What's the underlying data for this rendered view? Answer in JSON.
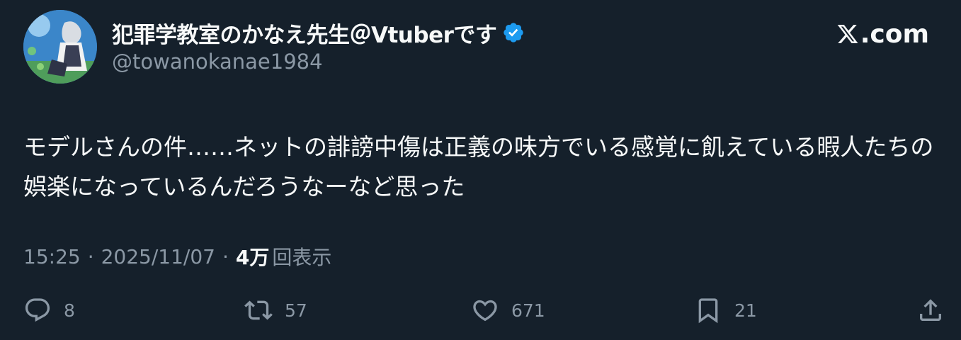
{
  "user": {
    "display_name": "犯罪学教室のかなえ先生＠Vtuberです",
    "handle": "@towanokanae1984",
    "verified": true,
    "avatar_icon": "avatar-image"
  },
  "brand": {
    "label": ".com",
    "logo_icon": "x-logo-icon"
  },
  "tweet": {
    "text": "モデルさんの件……ネットの誹謗中傷は正義の味方でいる感覚に飢えている暇人たちの娯楽になっているんだろうなーなど思った"
  },
  "meta": {
    "time": "15:25",
    "separator": "·",
    "date": "2025/11/07",
    "views_count": "4万",
    "views_label": "回表示"
  },
  "actions": {
    "reply_count": "8",
    "retweet_count": "57",
    "like_count": "671",
    "bookmark_count": "21"
  },
  "colors": {
    "background": "#15202b",
    "text": "#f7f9f9",
    "secondary": "#8b98a5",
    "verified": "#1d9bf0"
  }
}
